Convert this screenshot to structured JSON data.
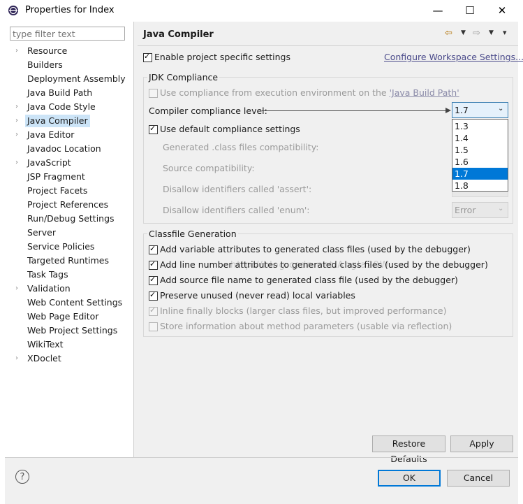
{
  "window": {
    "title": "Properties for Index",
    "minimize": "—",
    "maximize": "☐",
    "close": "✕"
  },
  "filter": {
    "placeholder": "type filter text"
  },
  "tree": [
    {
      "label": "Resource",
      "expandable": true
    },
    {
      "label": "Builders",
      "expandable": false
    },
    {
      "label": "Deployment Assembly",
      "expandable": false
    },
    {
      "label": "Java Build Path",
      "expandable": false
    },
    {
      "label": "Java Code Style",
      "expandable": true
    },
    {
      "label": "Java Compiler",
      "expandable": true,
      "selected": true
    },
    {
      "label": "Java Editor",
      "expandable": true
    },
    {
      "label": "Javadoc Location",
      "expandable": false
    },
    {
      "label": "JavaScript",
      "expandable": true
    },
    {
      "label": "JSP Fragment",
      "expandable": false
    },
    {
      "label": "Project Facets",
      "expandable": false
    },
    {
      "label": "Project References",
      "expandable": false
    },
    {
      "label": "Run/Debug Settings",
      "expandable": false
    },
    {
      "label": "Server",
      "expandable": false
    },
    {
      "label": "Service Policies",
      "expandable": false
    },
    {
      "label": "Targeted Runtimes",
      "expandable": false
    },
    {
      "label": "Task Tags",
      "expandable": false
    },
    {
      "label": "Validation",
      "expandable": true
    },
    {
      "label": "Web Content Settings",
      "expandable": false
    },
    {
      "label": "Web Page Editor",
      "expandable": false
    },
    {
      "label": "Web Project Settings",
      "expandable": false
    },
    {
      "label": "WikiText",
      "expandable": false
    },
    {
      "label": "XDoclet",
      "expandable": true
    }
  ],
  "page": {
    "title": "Java Compiler",
    "enable_specific": "Enable project specific settings",
    "configure_link": "Configure Workspace Settings...",
    "jdk_group": "JDK Compliance",
    "use_compliance_prefix": "Use compliance from execution environment on the ",
    "use_compliance_link": "'Java Build Path'",
    "compliance_level_label": "Compiler compliance level:",
    "compliance_value": "1.7",
    "compliance_options": [
      "1.3",
      "1.4",
      "1.5",
      "1.6",
      "1.7",
      "1.8"
    ],
    "use_default": "Use default compliance settings",
    "generated_class": "Generated .class files compatibility:",
    "source_compat": "Source compatibility:",
    "disallow_assert": "Disallow identifiers called 'assert':",
    "disallow_enum": "Disallow identifiers called 'enum':",
    "enum_value": "Error",
    "classfile_group": "Classfile Generation",
    "opt_variable": "Add variable attributes to generated class files (used by the debugger)",
    "opt_line": "Add line number attributes to generated class files (used by the debugger)",
    "opt_source": "Add source file name to generated class file (used by the debugger)",
    "opt_preserve": "Preserve unused (never read) local variables",
    "opt_inline": "Inline finally blocks (larger class files, but improved performance)",
    "opt_store": "Store information about method parameters (usable via reflection)",
    "watermark": "http://blog.csdn.net/Angla20W"
  },
  "buttons": {
    "restore": "Restore Defaults",
    "apply": "Apply",
    "ok": "OK",
    "cancel": "Cancel",
    "help": "?"
  },
  "colors": {
    "selection": "#0078d7",
    "tree_selection": "#cce4f7"
  }
}
